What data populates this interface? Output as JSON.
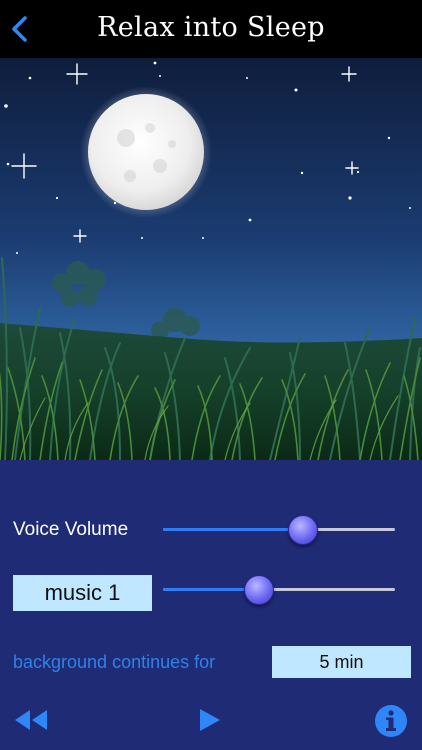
{
  "header": {
    "title": "Relax into Sleep",
    "back_icon": "chevron-left-icon"
  },
  "scene": {
    "description_icon": "night-moon-grass-illustration"
  },
  "controls": {
    "voice_volume_label": "Voice Volume",
    "voice_volume_value": 0.6,
    "music_label": "music 1",
    "music_volume_value": 0.41,
    "background_label": "background continues for",
    "background_duration": "5 min"
  },
  "toolbar": {
    "rewind_icon": "rewind-icon",
    "play_icon": "play-icon",
    "info_icon": "info-icon"
  },
  "colors": {
    "panel": "#1f2b74",
    "accent": "#2f82e8",
    "box": "#bfe7ff",
    "slider_fill": "#2f7cf4"
  }
}
